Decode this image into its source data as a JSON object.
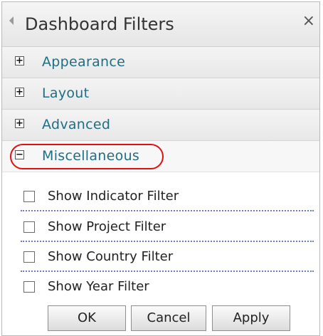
{
  "header": {
    "title": "Dashboard Filters",
    "close_symbol": "×"
  },
  "sections": [
    {
      "label": "Appearance",
      "toggle": "+",
      "expanded": false
    },
    {
      "label": "Layout",
      "toggle": "+",
      "expanded": false
    },
    {
      "label": "Advanced",
      "toggle": "+",
      "expanded": false
    },
    {
      "label": "Miscellaneous",
      "toggle": "−",
      "expanded": true
    }
  ],
  "options": [
    {
      "label": "Show Indicator Filter",
      "checked": false
    },
    {
      "label": "Show Project Filter",
      "checked": false
    },
    {
      "label": "Show Country Filter",
      "checked": false
    },
    {
      "label": "Show Year Filter",
      "checked": false
    }
  ],
  "buttons": {
    "ok": "OK",
    "cancel": "Cancel",
    "apply": "Apply"
  },
  "colors": {
    "section_text": "#1f6e84",
    "highlight": "#e01010",
    "separator": "#6a7fc0"
  }
}
